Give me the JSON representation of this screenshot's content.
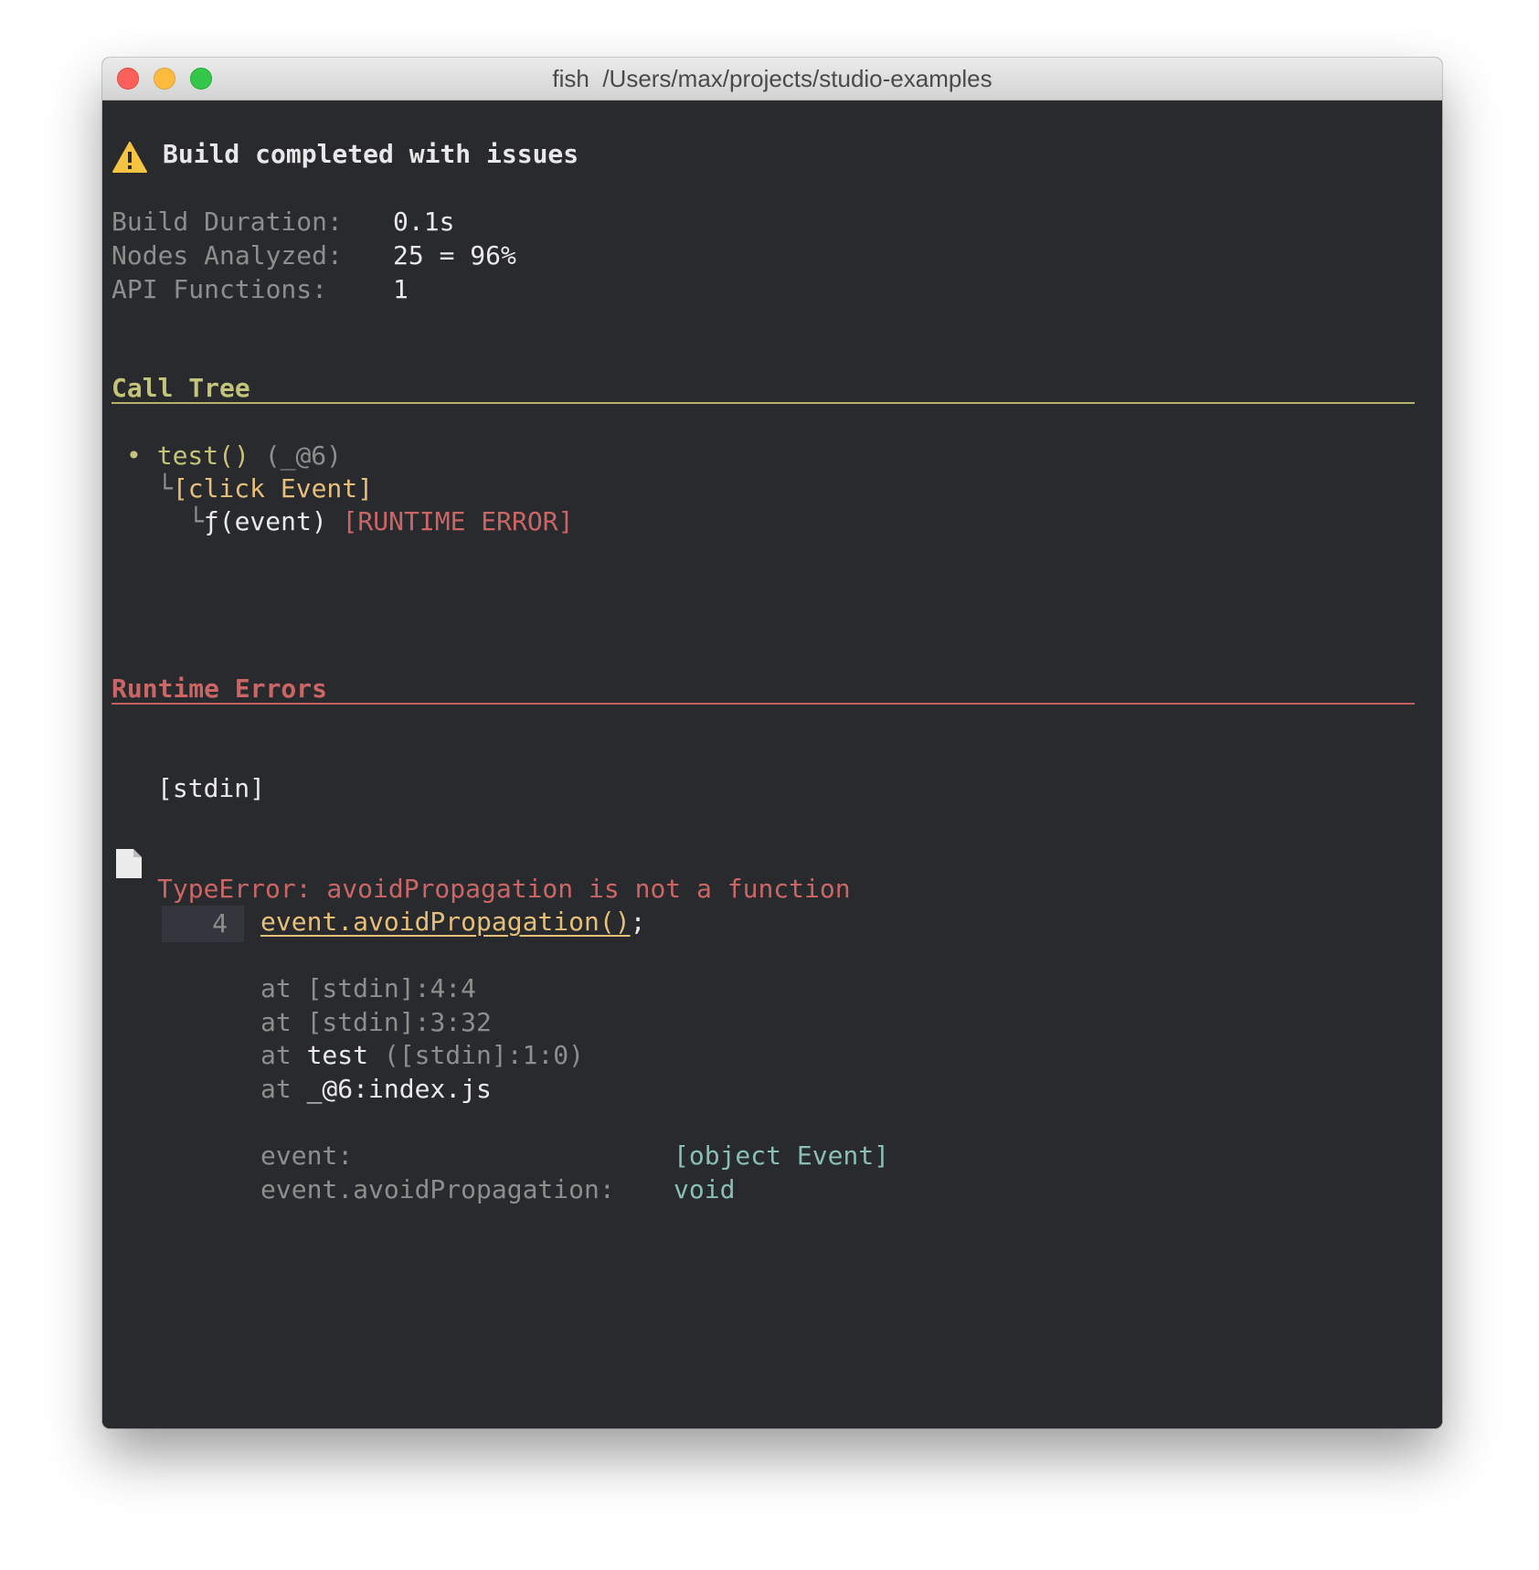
{
  "window": {
    "title": "fish  /Users/max/projects/studio-examples"
  },
  "build": {
    "status_icon": "warning-icon",
    "headline": "Build completed with issues",
    "stats": [
      {
        "label": "Build Duration:",
        "value": "0.1s"
      },
      {
        "label": "Nodes Analyzed:",
        "value": "25 = 96%"
      },
      {
        "label": "API Functions:",
        "value": "1"
      }
    ]
  },
  "call_tree": {
    "title": "Call Tree",
    "root": {
      "bullet": "•",
      "name": "test()",
      "id": "(_@6)"
    },
    "event": {
      "connector": "└",
      "label": "[click Event]"
    },
    "handler": {
      "connector": "└",
      "name": "ƒ(event)",
      "tag": "[RUNTIME ERROR]"
    }
  },
  "runtime_errors": {
    "title": "Runtime Errors",
    "file_icon": "document-icon",
    "file": "[stdin]",
    "error_message": "TypeError: avoidPropagation is not a function",
    "line_number": "4",
    "code_highlight": "event.avoidPropagation()",
    "code_rest": ";",
    "stack": [
      {
        "prefix": "at ",
        "highlight": "",
        "text": "[stdin]:4:4"
      },
      {
        "prefix": "at ",
        "highlight": "",
        "text": "[stdin]:3:32"
      },
      {
        "prefix": "at ",
        "highlight": "test",
        "text": " ([stdin]:1:0)"
      },
      {
        "prefix": "at ",
        "highlight": "_@6:index.js",
        "text": ""
      }
    ],
    "variables": [
      {
        "name": "event:",
        "value": "[object Event]"
      },
      {
        "name": "event.avoidPropagation:",
        "value": "void"
      }
    ]
  },
  "colors": {
    "background": "#282a2e",
    "call_tree_accent": "#c3c37a",
    "error_accent": "#cc6666",
    "event_accent": "#e6c07b",
    "value_accent": "#8abeb7"
  }
}
